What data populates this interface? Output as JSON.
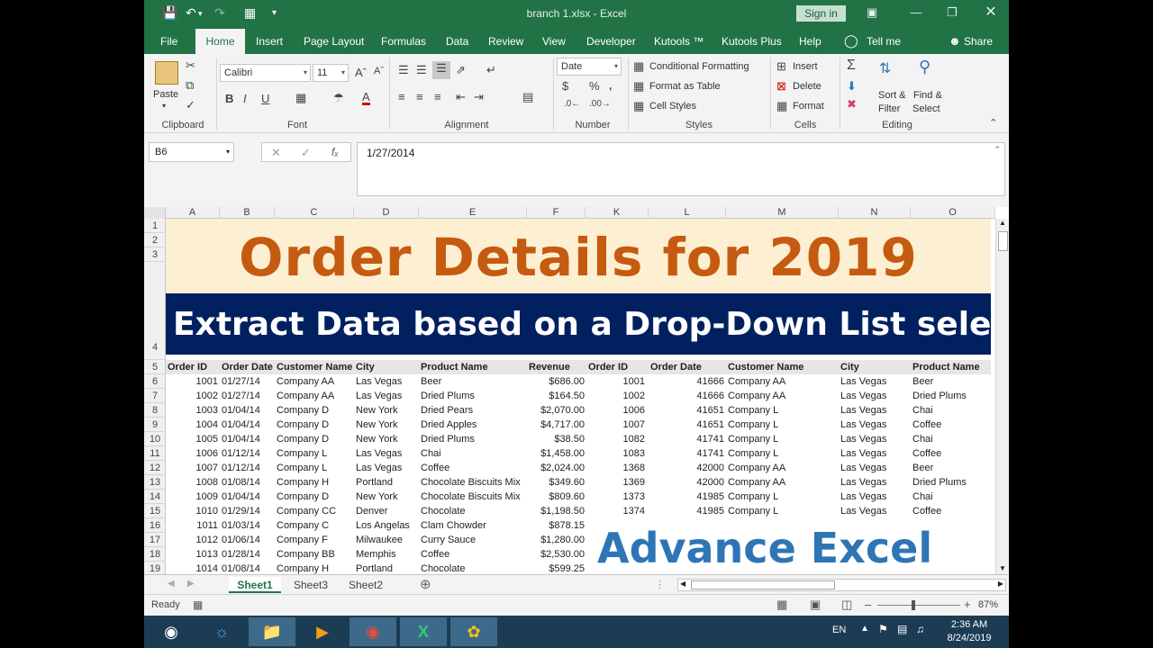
{
  "window": {
    "title": "branch 1.xlsx  -  Excel",
    "sign_in": "Sign in"
  },
  "ribbon_tabs": [
    "File",
    "Home",
    "Insert",
    "Page Layout",
    "Formulas",
    "Data",
    "Review",
    "View",
    "Developer",
    "Kutools ™",
    "Kutools Plus",
    "Help"
  ],
  "tell_me": "Tell me",
  "share": "Share",
  "ribbon": {
    "paste": "Paste",
    "font_name": "Calibri",
    "font_size": "11",
    "number_format": "Date",
    "conditional_formatting": "Conditional Formatting",
    "format_as_table": "Format as Table",
    "cell_styles": "Cell Styles",
    "insert": "Insert",
    "delete": "Delete",
    "format": "Format",
    "sort_filter": [
      "Sort &",
      "Filter"
    ],
    "find_select": [
      "Find &",
      "Select"
    ],
    "groups": [
      "Clipboard",
      "Font",
      "Alignment",
      "Number",
      "Styles",
      "Cells",
      "Editing"
    ]
  },
  "formula_bar": {
    "name_box": "B6",
    "formula": "1/27/2014"
  },
  "columns": [
    "A",
    "B",
    "C",
    "D",
    "E",
    "F",
    "K",
    "L",
    "M",
    "N",
    "O"
  ],
  "rows": [
    "1",
    "2",
    "3",
    "4",
    "5",
    "6",
    "7",
    "8",
    "9",
    "10",
    "11",
    "12",
    "13",
    "14",
    "15",
    "16",
    "17",
    "18",
    "19"
  ],
  "sheet": {
    "title": "Order Details for 2019",
    "subtitle": "Extract Data based on a Drop-Down List select",
    "left_headers": [
      "Order ID",
      "Order Date",
      "Customer Name",
      "City",
      "Product Name",
      "Revenue"
    ],
    "right_headers": [
      "Order ID",
      "Order Date",
      "Customer Name",
      "City",
      "Product Name"
    ],
    "left_rows": [
      [
        "1001",
        "01/27/14",
        "Company AA",
        "Las Vegas",
        "Beer",
        "$686.00"
      ],
      [
        "1002",
        "01/27/14",
        "Company AA",
        "Las Vegas",
        "Dried Plums",
        "$164.50"
      ],
      [
        "1003",
        "01/04/14",
        "Company D",
        "New York",
        "Dried Pears",
        "$2,070.00"
      ],
      [
        "1004",
        "01/04/14",
        "Company D",
        "New York",
        "Dried Apples",
        "$4,717.00"
      ],
      [
        "1005",
        "01/04/14",
        "Company D",
        "New York",
        "Dried Plums",
        "$38.50"
      ],
      [
        "1006",
        "01/12/14",
        "Company L",
        "Las Vegas",
        "Chai",
        "$1,458.00"
      ],
      [
        "1007",
        "01/12/14",
        "Company L",
        "Las Vegas",
        "Coffee",
        "$2,024.00"
      ],
      [
        "1008",
        "01/08/14",
        "Company H",
        "Portland",
        "Chocolate Biscuits Mix",
        "$349.60"
      ],
      [
        "1009",
        "01/04/14",
        "Company D",
        "New York",
        "Chocolate Biscuits Mix",
        "$809.60"
      ],
      [
        "1010",
        "01/29/14",
        "Company CC",
        "Denver",
        "Chocolate",
        "$1,198.50"
      ],
      [
        "1011",
        "01/03/14",
        "Company C",
        "Los Angelas",
        "Clam Chowder",
        "$878.15"
      ],
      [
        "1012",
        "01/06/14",
        "Company F",
        "Milwaukee",
        "Curry Sauce",
        "$1,280.00"
      ],
      [
        "1013",
        "01/28/14",
        "Company BB",
        "Memphis",
        "Coffee",
        "$2,530.00"
      ],
      [
        "1014",
        "01/08/14",
        "Company H",
        "Portland",
        "Chocolate",
        "$599.25"
      ]
    ],
    "right_rows": [
      [
        "1001",
        "41666",
        "Company AA",
        "Las Vegas",
        "Beer"
      ],
      [
        "1002",
        "41666",
        "Company AA",
        "Las Vegas",
        "Dried Plums"
      ],
      [
        "1006",
        "41651",
        "Company L",
        "Las Vegas",
        "Chai"
      ],
      [
        "1007",
        "41651",
        "Company L",
        "Las Vegas",
        "Coffee"
      ],
      [
        "1082",
        "41741",
        "Company L",
        "Las Vegas",
        "Chai"
      ],
      [
        "1083",
        "41741",
        "Company L",
        "Las Vegas",
        "Coffee"
      ],
      [
        "1368",
        "42000",
        "Company AA",
        "Las Vegas",
        "Beer"
      ],
      [
        "1369",
        "42000",
        "Company AA",
        "Las Vegas",
        "Dried Plums"
      ],
      [
        "1373",
        "41985",
        "Company L",
        "Las Vegas",
        "Chai"
      ],
      [
        "1374",
        "41985",
        "Company L",
        "Las Vegas",
        "Coffee"
      ]
    ],
    "watermark": "Advance Excel"
  },
  "sheet_tabs": [
    "Sheet1",
    "Sheet3",
    "Sheet2"
  ],
  "status": {
    "ready": "Ready",
    "zoom": "87%"
  },
  "taskbar": {
    "lang": "EN",
    "time": "2:36 AM",
    "date": "8/24/2019"
  }
}
